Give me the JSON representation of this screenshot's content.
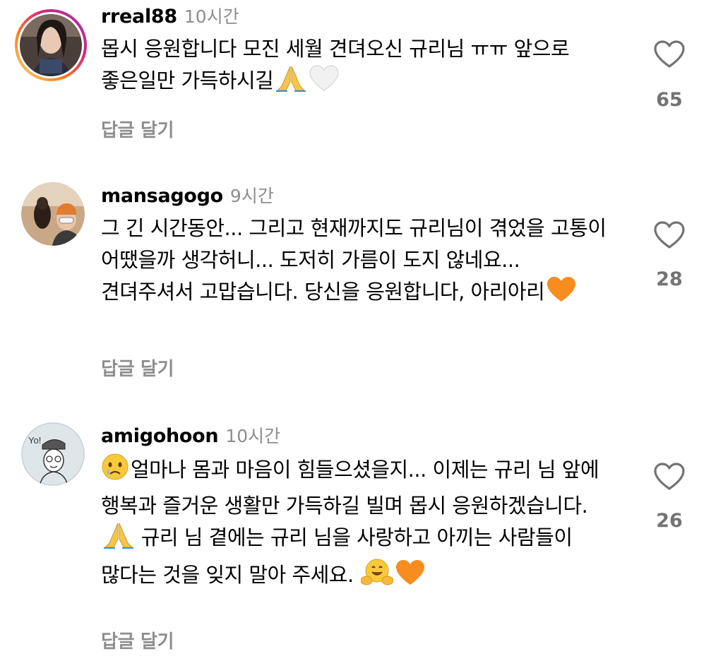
{
  "comments": [
    {
      "username": "rreal88",
      "time": "10시간",
      "text": "몹시 응원합니다 모진 세월 견뎌오신 규리님 ㅠㅠ 앞으로 좋은일만 가득하시길",
      "emojis": [
        "folded-hands",
        "white-heart"
      ],
      "likes": "65",
      "reply_label": "답글 달기",
      "avatar_story_ring": true
    },
    {
      "username": "mansagogo",
      "time": "9시간",
      "text": "그 긴 시간동안... 그리고 현재까지도 규리님이 겪었을 고통이  어땠을까 생각허니... 도저히 가름이 도지 않네요... 견뎌주셔서 고맙습니다. 당신을 응원합니다, 아리아리",
      "emojis": [
        "orange-heart"
      ],
      "likes": "28",
      "reply_label": "답글 달기"
    },
    {
      "username": "amigohoon",
      "time": "10시간",
      "text_part1": "얼마나 몸과 마음이 힘들으셨을지... 이제는 규리 님 앞에 행복과 즐거운 생활만 가득하길 빌며 몹시 응원하겠습니다. ",
      "text_part2": " 규리 님 곁에는 규리 님을 사랑하고 아끼는 사람들이 많다는 것을 잊지 말아 주세요. ",
      "emojis": [
        "crying-face",
        "folded-hands",
        "hugging-face",
        "orange-heart"
      ],
      "likes": "26",
      "reply_label": "답글 달기"
    }
  ]
}
